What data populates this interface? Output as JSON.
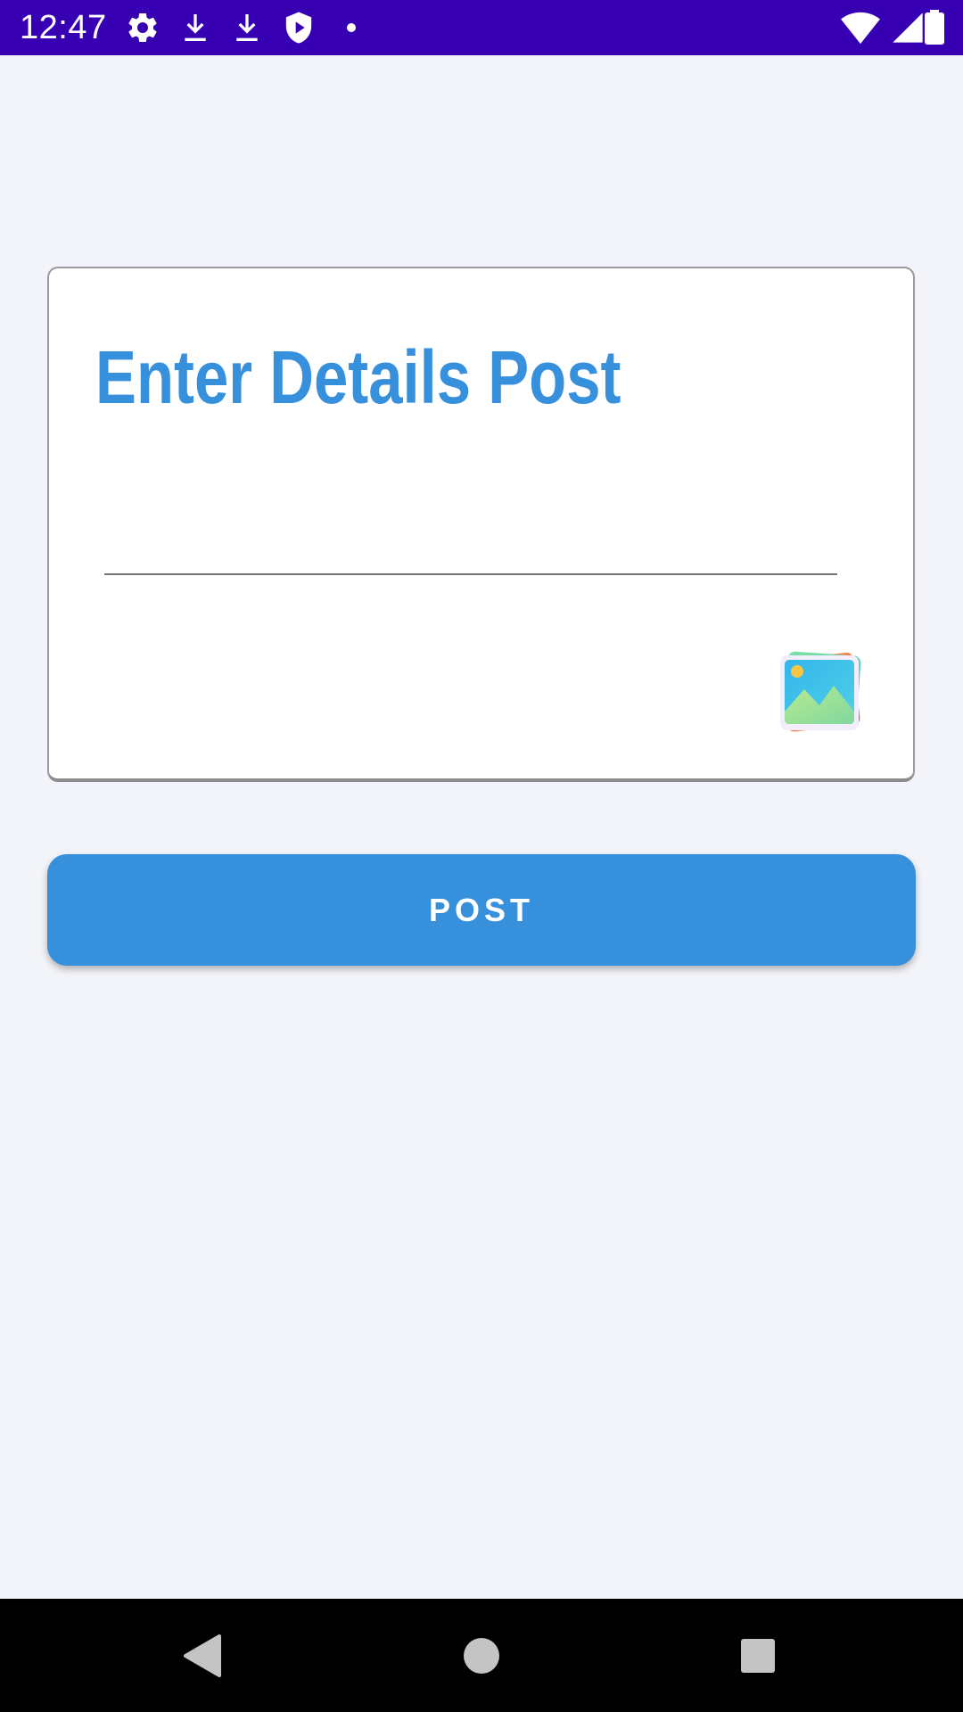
{
  "status_bar": {
    "time": "12:47",
    "left_icons": [
      "gear-icon",
      "download-icon",
      "download-icon",
      "shield-play-icon",
      "dot-icon"
    ],
    "right_icons": [
      "wifi-icon",
      "signal-icon",
      "battery-icon"
    ],
    "background": "#3700b3"
  },
  "card": {
    "title": "Enter Details Post",
    "input_value": "",
    "input_placeholder": "",
    "gallery_icon": "gallery-icon"
  },
  "post_button": {
    "label": "POST",
    "color": "#3790dc"
  },
  "nav_bar": {
    "items": [
      "back-icon",
      "home-icon",
      "recents-icon"
    ]
  }
}
